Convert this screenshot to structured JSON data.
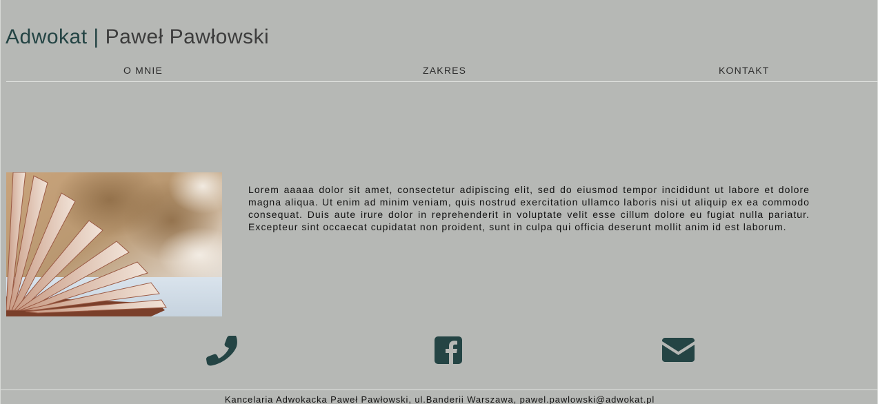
{
  "header": {
    "brand": "Adwokat",
    "separator": "|",
    "name": "Paweł Pawłowski"
  },
  "nav": {
    "items": [
      {
        "label": "O MNIE"
      },
      {
        "label": "ZAKRES"
      },
      {
        "label": "KONTAKT"
      }
    ]
  },
  "main": {
    "image_icon": "open-book-photo",
    "about_text": "Lorem aaaaa dolor sit amet, consectetur adipiscing elit, sed do eiusmod tempor incididunt ut labore et dolore magna aliqua. Ut enim ad minim veniam, quis nostrud exercitation ullamco laboris nisi ut aliquip ex ea commodo consequat. Duis aute irure dolor in reprehenderit in voluptate velit esse cillum dolore eu fugiat nulla pariatur. Excepteur sint occaecat cupidatat non proident, sunt in culpa qui officia deserunt mollit anim id est laborum."
  },
  "contacts": {
    "icons": [
      "phone-icon",
      "facebook-icon",
      "envelope-icon"
    ],
    "icon_color": "#244444"
  },
  "footer": {
    "text": "Kancelaria Adwokacka Paweł Pawłowski, ul.Banderii Warszawa, pawel.pawlowski@adwokat.pl"
  },
  "colors": {
    "background": "#b6b8b5",
    "brand": "#244444",
    "divider": "#e4e6e3"
  }
}
